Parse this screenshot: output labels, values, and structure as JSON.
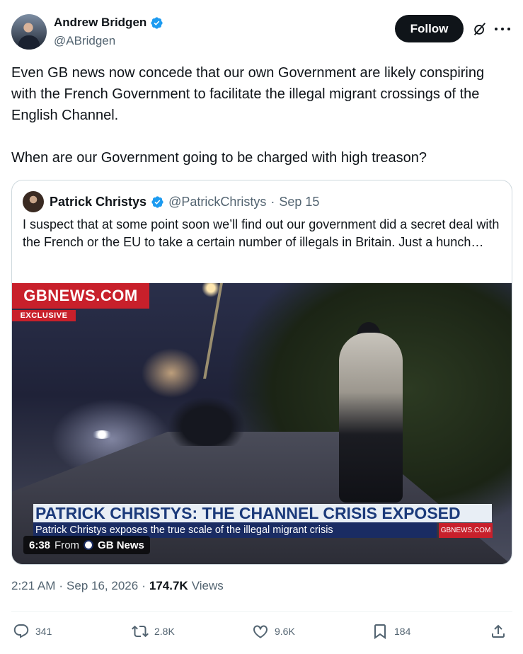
{
  "author": {
    "display_name": "Andrew Bridgen",
    "handle": "@ABridgen",
    "verified_icon": "verified-badge-icon"
  },
  "header_actions": {
    "follow_label": "Follow",
    "grok_icon": "grok-icon",
    "more_icon": "more-icon"
  },
  "tweet": {
    "paragraph_1": "Even GB news now concede that our own Government are likely conspiring with the French Government to facilitate the illegal migrant crossings of the English Channel.",
    "paragraph_2": "When are our Government going to be charged with high treason?"
  },
  "quote": {
    "display_name": "Patrick Christys",
    "handle": "@PatrickChristys",
    "separator": "·",
    "date": "Sep 15",
    "text": "I suspect that at some point soon we’ll find out our government did a secret deal with the French or the EU to take a certain number of illegals in Britain. Just a hunch…",
    "video": {
      "logo": "GBNEWS.COM",
      "exclusive": "EXCLUSIVE",
      "banner_title": "PATRICK CHRISTYS: THE CHANNEL CRISIS EXPOSED",
      "banner_subtitle": "Patrick Christys exposes the true scale of the illegal migrant crisis",
      "banner_site": "GBNEWS.COM",
      "duration": "6:38",
      "from_label": "From",
      "source": "GB News"
    }
  },
  "meta": {
    "time": "2:21 AM",
    "separator": "·",
    "date": "Sep 16, 2026",
    "views_count": "174.7K",
    "views_label": "Views"
  },
  "actions": {
    "replies": "341",
    "reposts": "2.8K",
    "likes": "9.6K",
    "bookmarks": "184"
  },
  "colors": {
    "text_primary": "#0f1419",
    "text_secondary": "#536471",
    "verified_blue": "#1d9bf0",
    "gb_red": "#c8202b",
    "gb_navy": "#1a2c63"
  }
}
